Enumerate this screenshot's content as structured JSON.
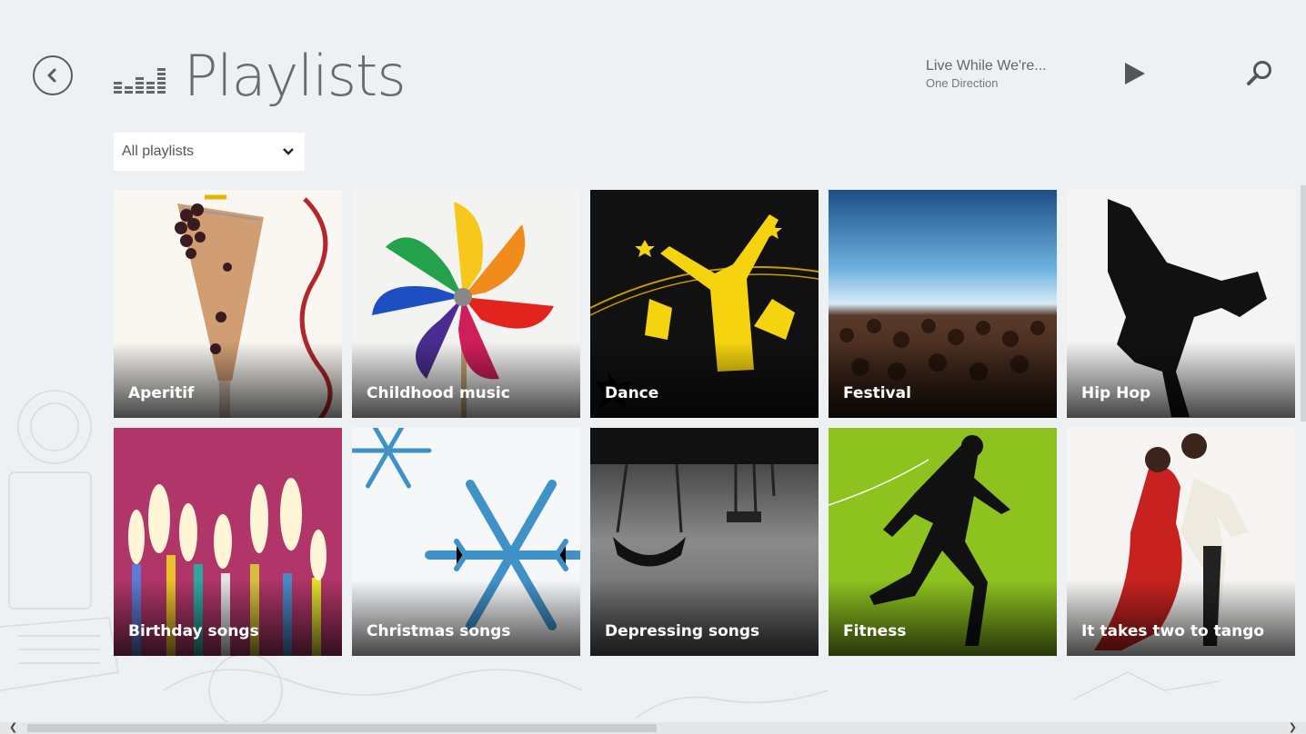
{
  "header": {
    "title": "Playlists",
    "back_icon": "back-arrow-icon",
    "logo_icon": "equalizer-icon"
  },
  "now_playing": {
    "title": "Live While We're...",
    "artist": "One Direction",
    "play_icon": "play-icon",
    "search_icon": "search-icon"
  },
  "filter": {
    "selected": "All playlists",
    "icon": "chevron-down-icon"
  },
  "playlists": [
    {
      "label": "Aperitif",
      "art": "champagne-glass"
    },
    {
      "label": "Childhood music",
      "art": "pinwheel"
    },
    {
      "label": "Dance",
      "art": "dancer-silhouettes"
    },
    {
      "label": "Festival",
      "art": "concert-crowd"
    },
    {
      "label": "Hip Hop",
      "art": "breakdancer-silhouette"
    },
    {
      "label": "Birthday songs",
      "art": "birthday-candles"
    },
    {
      "label": "Christmas songs",
      "art": "snowflakes"
    },
    {
      "label": "Depressing songs",
      "art": "swings"
    },
    {
      "label": "Fitness",
      "art": "runner-silhouette"
    },
    {
      "label": "It takes two to tango",
      "art": "tango-dancers"
    }
  ],
  "colors": {
    "background": "#eef1f3",
    "fitness_green": "#8dc21f",
    "birthday_magenta": "#b03568"
  }
}
